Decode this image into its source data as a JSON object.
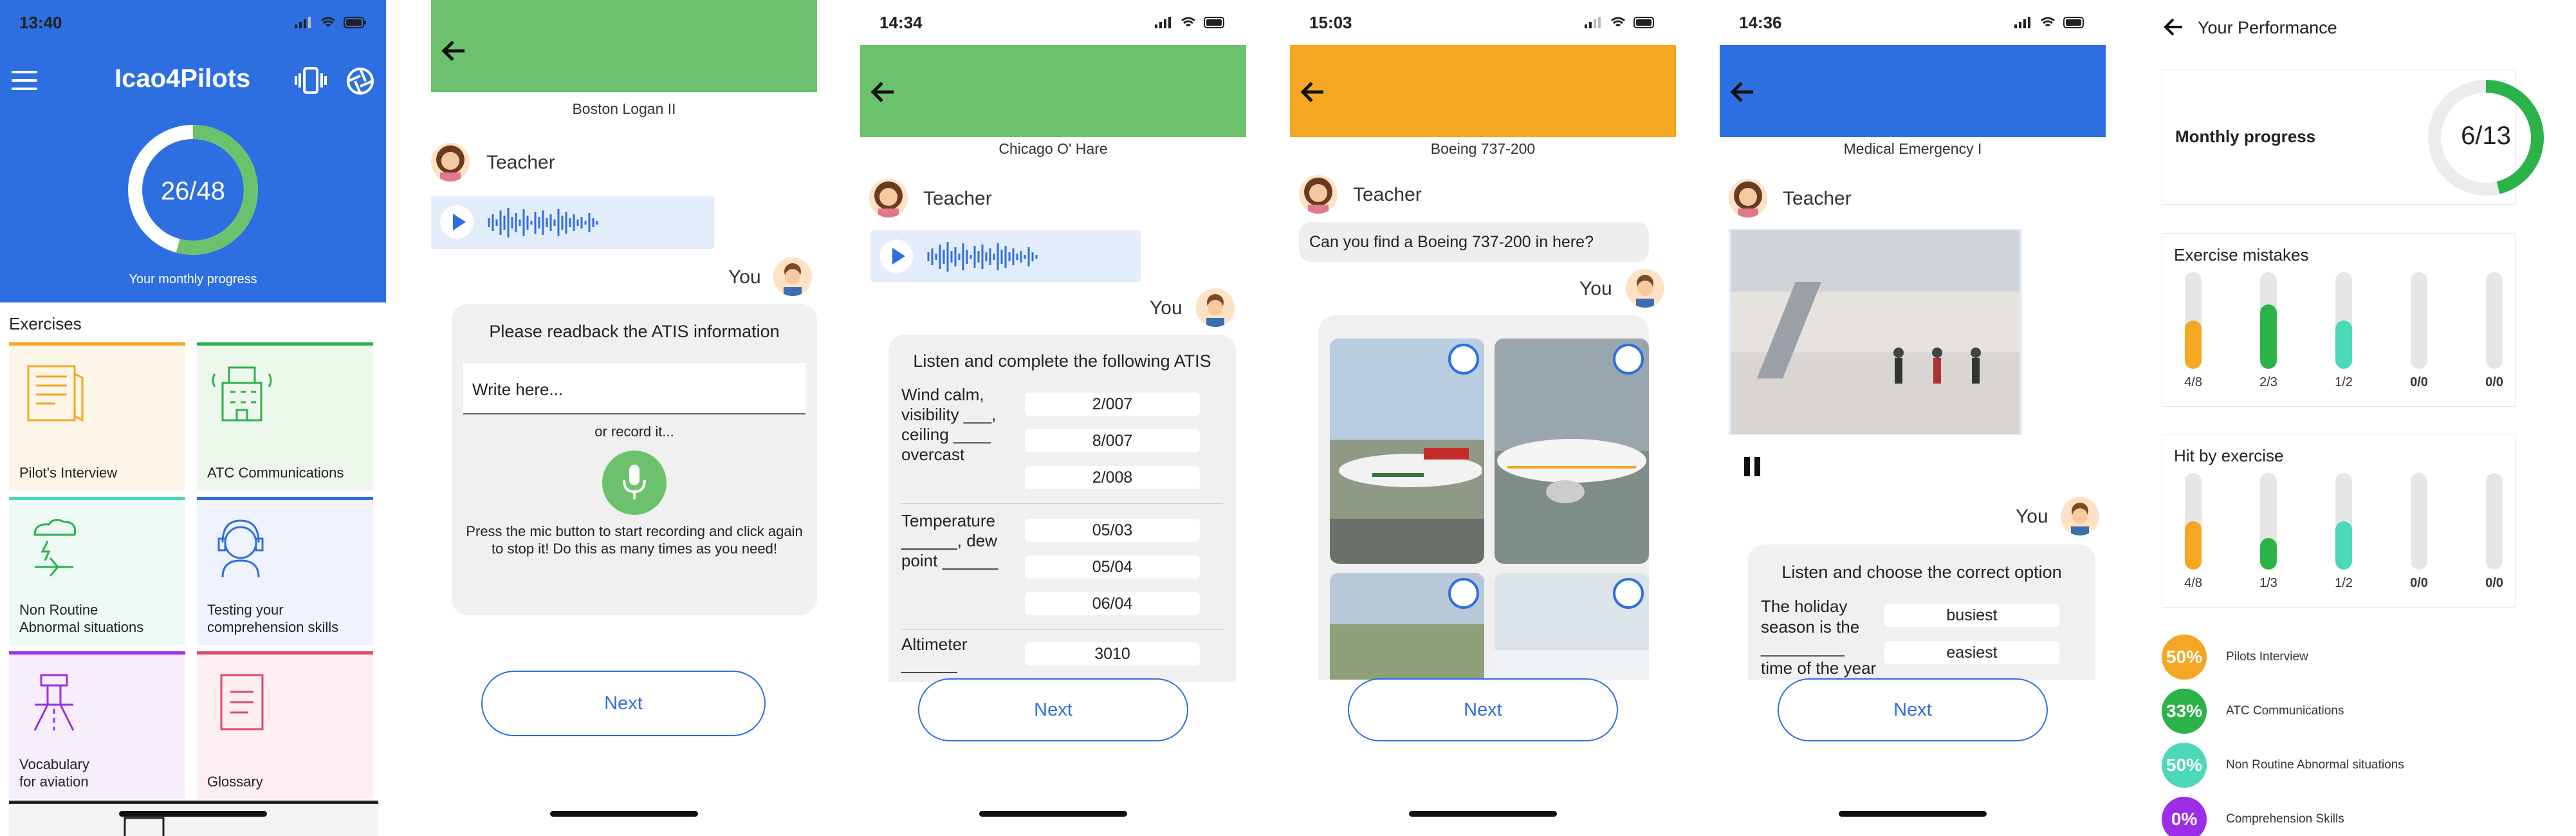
{
  "colors": {
    "blue": "#2d6fe0",
    "green": "#6cc26c",
    "orange": "#f5a623",
    "exgreen": "#2bb34a",
    "teal": "#4cd9b8",
    "purple": "#9b2ee6"
  },
  "s1": {
    "time": "13:40",
    "logo": "Icao4Pilots",
    "progress_value": "26/48",
    "progress_fraction": 0.5417,
    "progress_label": "Your monthly progress",
    "exercises_label": "Exercises",
    "tiles": [
      {
        "label": "Pilot's Interview",
        "icon": "book-icon"
      },
      {
        "label": "ATC Communications",
        "icon": "control-tower-icon"
      },
      {
        "label": "Non Routine\nAbnormal situations",
        "icon": "storm-plane-icon"
      },
      {
        "label": "Testing your\ncomprehension skills",
        "icon": "headset-pilot-icon"
      },
      {
        "label": "Vocabulary\nfor aviation",
        "icon": "runway-tower-icon"
      },
      {
        "label": "Glossary",
        "icon": "glossary-book-icon"
      }
    ]
  },
  "s2": {
    "caption": "Boston Logan II",
    "teacher": "Teacher",
    "you": "You",
    "title": "Please readback the ATIS information",
    "input_placeholder": "Write here...",
    "or_record": "or record it...",
    "instructions": "Press the mic button to start recording and click again to stop it! Do this as many times as you need!",
    "next": "Next"
  },
  "s3": {
    "time": "14:34",
    "caption": "Chicago O' Hare",
    "teacher": "Teacher",
    "you": "You",
    "title": "Listen and complete the following ATIS",
    "rows": [
      {
        "text": "Wind calm,\nvisibility ___,\nceiling ____\novercast",
        "options": [
          "2/007",
          "8/007",
          "2/008"
        ]
      },
      {
        "text": "Temperature\n______, dew\npoint ______",
        "options": [
          "05/03",
          "05/04",
          "06/04"
        ]
      },
      {
        "text": "Altimeter\n______",
        "options": [
          "3010"
        ]
      }
    ],
    "next": "Next"
  },
  "s4": {
    "time": "15:03",
    "caption": "Boeing 737-200",
    "teacher": "Teacher",
    "question": "Can you find a Boeing 737-200 in here?",
    "you": "You",
    "next": "Next"
  },
  "s5": {
    "time": "14:36",
    "caption": "Medical Emergency I",
    "teacher": "Teacher",
    "you": "You",
    "title": "Listen and choose the correct option",
    "question": "The holiday\nseason is the\n_________\ntime of the year",
    "options": [
      "busiest",
      "easiest"
    ],
    "next": "Next"
  },
  "s6": {
    "header": "Your Performance",
    "monthly_label": "Monthly progress",
    "monthly_value": "6/13",
    "monthly_fraction": 0.4615,
    "mistakes_title": "Exercise mistakes",
    "mistakes": [
      {
        "label": "4/8",
        "fraction": 0.5,
        "color": "#f5a623",
        "bold": false
      },
      {
        "label": "2/3",
        "fraction": 0.67,
        "color": "#2bb34a",
        "bold": false
      },
      {
        "label": "1/2",
        "fraction": 0.5,
        "color": "#4cd9b8",
        "bold": false
      },
      {
        "label": "0/0",
        "fraction": 0,
        "color": "#cccccc",
        "bold": true
      },
      {
        "label": "0/0",
        "fraction": 0,
        "color": "#cccccc",
        "bold": true
      }
    ],
    "hits_title": "Hit by exercise",
    "hits": [
      {
        "label": "4/8",
        "fraction": 0.5,
        "color": "#f5a623",
        "bold": false
      },
      {
        "label": "1/3",
        "fraction": 0.33,
        "color": "#2bb34a",
        "bold": false
      },
      {
        "label": "1/2",
        "fraction": 0.5,
        "color": "#4cd9b8",
        "bold": false
      },
      {
        "label": "0/0",
        "fraction": 0,
        "color": "#cccccc",
        "bold": true
      },
      {
        "label": "0/0",
        "fraction": 0,
        "color": "#cccccc",
        "bold": true
      }
    ],
    "legend": [
      {
        "value": "50%",
        "label": "Pilots Interview",
        "color": "#f5a623"
      },
      {
        "value": "33%",
        "label": "ATC Communications",
        "color": "#2bb34a"
      },
      {
        "value": "50%",
        "label": "Non Routine Abnormal situations",
        "color": "#4cd9b8"
      },
      {
        "value": "0%",
        "label": "Comprehension Skills",
        "color": "#9b2ee6"
      }
    ]
  }
}
